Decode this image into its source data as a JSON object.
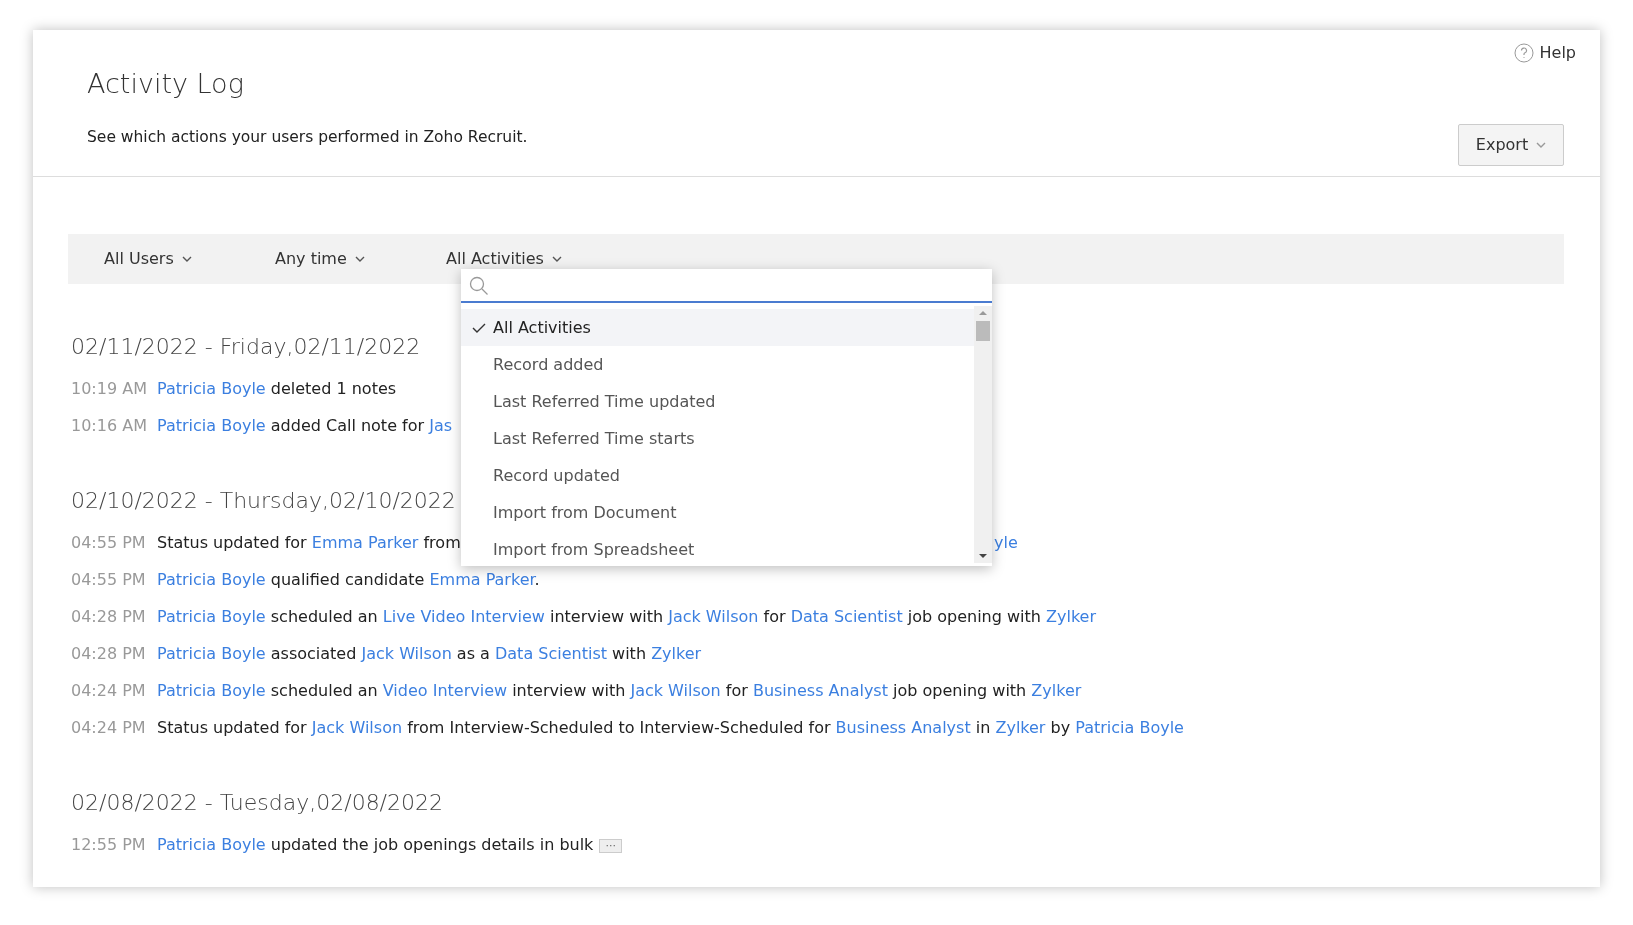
{
  "header": {
    "help": "Help",
    "title": "Activity Log",
    "subtitle": "See which actions your users performed in Zoho Recruit.",
    "export": "Export"
  },
  "filters": [
    {
      "label": "All Users"
    },
    {
      "label": "Any time"
    },
    {
      "label": "All Activities"
    }
  ],
  "dropdown": {
    "items": [
      {
        "label": "All Activities",
        "selected": true
      },
      {
        "label": "Record added",
        "selected": false
      },
      {
        "label": "Last Referred Time updated",
        "selected": false
      },
      {
        "label": "Last Referred Time starts",
        "selected": false
      },
      {
        "label": "Record updated",
        "selected": false
      },
      {
        "label": "Import from Document",
        "selected": false
      },
      {
        "label": "Import from Spreadsheet",
        "selected": false
      }
    ]
  },
  "days": [
    {
      "heading": "02/11/2022 - Friday,02/11/2022",
      "entries": [
        {
          "time": "10:19 AM",
          "parts": [
            {
              "kind": "link",
              "text": "Patricia Boyle"
            },
            {
              "kind": "text",
              "text": "deleted 1 notes"
            }
          ]
        },
        {
          "time": "10:16 AM",
          "parts": [
            {
              "kind": "link",
              "text": "Patricia Boyle"
            },
            {
              "kind": "text",
              "text": "added Call note for"
            },
            {
              "kind": "link",
              "text": "Jas"
            }
          ]
        }
      ]
    },
    {
      "heading": "02/10/2022 - Thursday,02/10/2022",
      "entries": [
        {
          "time": "04:55 PM",
          "parts": [
            {
              "kind": "text",
              "text": "Status updated for"
            },
            {
              "kind": "link",
              "text": "Emma Parker"
            },
            {
              "kind": "text",
              "text": "from"
            }
          ],
          "tail": "yle"
        },
        {
          "time": "04:55 PM",
          "parts": [
            {
              "kind": "link",
              "text": "Patricia Boyle"
            },
            {
              "kind": "text",
              "text": "qualified candidate"
            },
            {
              "kind": "link",
              "text": "Emma Parker"
            },
            {
              "kind": "text",
              "text": "."
            }
          ]
        },
        {
          "time": "04:28 PM",
          "parts": [
            {
              "kind": "link",
              "text": "Patricia Boyle"
            },
            {
              "kind": "text",
              "text": "scheduled an"
            },
            {
              "kind": "link",
              "text": "Live Video Interview"
            },
            {
              "kind": "text",
              "text": "interview with"
            },
            {
              "kind": "link",
              "text": "Jack Wilson"
            },
            {
              "kind": "text",
              "text": "for"
            },
            {
              "kind": "link",
              "text": "Data Scientist"
            },
            {
              "kind": "text",
              "text": "job opening with"
            },
            {
              "kind": "link",
              "text": "Zylker"
            }
          ]
        },
        {
          "time": "04:28 PM",
          "parts": [
            {
              "kind": "link",
              "text": "Patricia Boyle"
            },
            {
              "kind": "text",
              "text": "associated"
            },
            {
              "kind": "link",
              "text": "Jack Wilson"
            },
            {
              "kind": "text",
              "text": "as a"
            },
            {
              "kind": "link",
              "text": "Data Scientist"
            },
            {
              "kind": "text",
              "text": "with"
            },
            {
              "kind": "link",
              "text": "Zylker"
            }
          ]
        },
        {
          "time": "04:24 PM",
          "parts": [
            {
              "kind": "link",
              "text": "Patricia Boyle"
            },
            {
              "kind": "text",
              "text": "scheduled an"
            },
            {
              "kind": "link",
              "text": "Video Interview"
            },
            {
              "kind": "text",
              "text": "interview with"
            },
            {
              "kind": "link",
              "text": "Jack Wilson"
            },
            {
              "kind": "text",
              "text": "for"
            },
            {
              "kind": "link",
              "text": "Business Analyst"
            },
            {
              "kind": "text",
              "text": "job opening with"
            },
            {
              "kind": "link",
              "text": "Zylker"
            }
          ]
        },
        {
          "time": "04:24 PM",
          "parts": [
            {
              "kind": "text",
              "text": "Status updated for"
            },
            {
              "kind": "link",
              "text": "Jack Wilson"
            },
            {
              "kind": "text",
              "text": "from Interview-Scheduled to Interview-Scheduled for"
            },
            {
              "kind": "link",
              "text": "Business Analyst"
            },
            {
              "kind": "text",
              "text": "in"
            },
            {
              "kind": "link",
              "text": "Zylker"
            },
            {
              "kind": "text",
              "text": "by"
            },
            {
              "kind": "link",
              "text": "Patricia Boyle"
            }
          ]
        }
      ]
    },
    {
      "heading": "02/08/2022 - Tuesday,02/08/2022",
      "entries": [
        {
          "time": "12:55 PM",
          "parts": [
            {
              "kind": "link",
              "text": "Patricia Boyle"
            },
            {
              "kind": "text",
              "text": "updated the job openings details in bulk"
            },
            {
              "kind": "more",
              "text": "···"
            }
          ]
        }
      ]
    }
  ]
}
